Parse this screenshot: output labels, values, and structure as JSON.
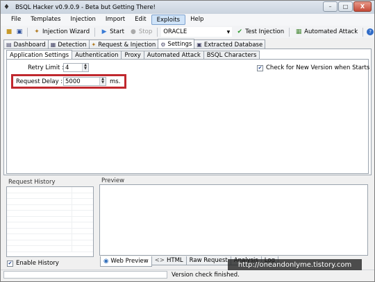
{
  "window": {
    "title": "BSQL Hacker v0.9.0.9 - Beta but Getting There!",
    "controls": {
      "minimize": "–",
      "maximize": "□",
      "close": "X"
    }
  },
  "menu": [
    "File",
    "Templates",
    "Injection",
    "Import",
    "Edit",
    "Exploits",
    "Help"
  ],
  "menu_active_index": 5,
  "toolbar": {
    "injection_wizard": "Injection Wizard",
    "start": "Start",
    "stop": "Stop",
    "db_combo_value": "ORACLE",
    "test_injection": "Test Injection",
    "automated_attack": "Automated Attack"
  },
  "main_tabs": [
    "Dashboard",
    "Detection",
    "Request & Injection",
    "Settings",
    "Extracted Database"
  ],
  "main_tab_selected": 3,
  "sub_tabs": [
    "Application Settings",
    "Authentication",
    "Proxy",
    "Automated Attack",
    "BSQL Characters"
  ],
  "sub_tab_selected": 0,
  "settings": {
    "retry_limit_label": "Retry Limit :",
    "retry_limit_value": "4",
    "request_delay_label": "Request Delay :",
    "request_delay_value": "5000",
    "request_delay_unit": "ms.",
    "check_version_label": "Check for New Version when Starts",
    "check_version_checked": true
  },
  "request_history": {
    "title": "Request History",
    "enable_history_label": "Enable History",
    "enable_history_checked": true
  },
  "preview": {
    "title": "Preview",
    "tabs": [
      "Web Preview",
      "HTML",
      "Raw Request",
      "Analysis",
      "Log"
    ]
  },
  "status": {
    "text": "Version check finished."
  },
  "watermark": "http://oneandonlyme.tistory.com",
  "colors": {
    "highlight": "#c0282e",
    "menu_active": "#cfe3f8"
  }
}
